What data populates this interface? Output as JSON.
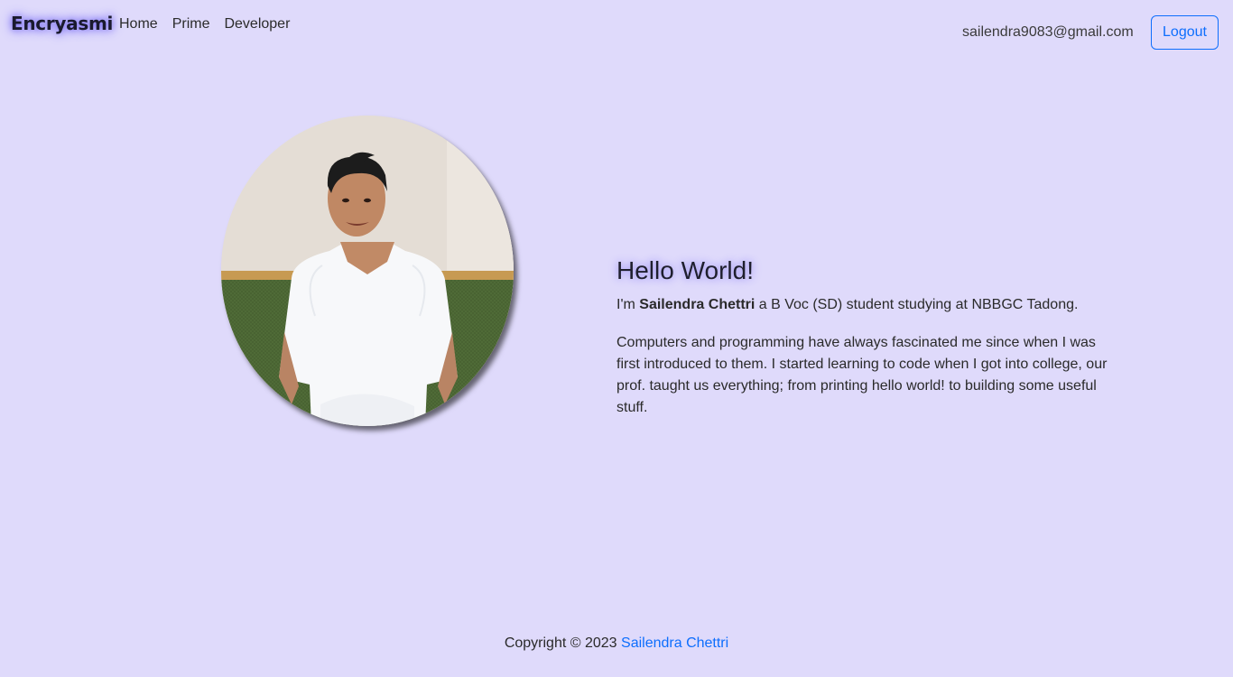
{
  "navbar": {
    "brand": "Encryasmi",
    "links": [
      {
        "label": "Home"
      },
      {
        "label": "Prime"
      },
      {
        "label": "Developer"
      }
    ],
    "user_email": "sailendra9083@gmail.com",
    "logout_label": "Logout"
  },
  "hero": {
    "title": "Hello World!",
    "intro_prefix": "I'm ",
    "name": "Sailendra Chettri",
    "intro_suffix": " a B Voc (SD) student studying at NBBGC Tadong.",
    "bio": "Computers and programming have always fascinated me since when I was first introduced to them. I started learning to code when I got into college, our prof. taught us everything; from printing hello world! to building some useful stuff."
  },
  "footer": {
    "copyright": "Copyright © 2023 ",
    "author_link": "Sailendra Chettri"
  },
  "colors": {
    "background": "#dfdafb",
    "accent": "#0d6efd",
    "glow": "#8f84ff"
  }
}
